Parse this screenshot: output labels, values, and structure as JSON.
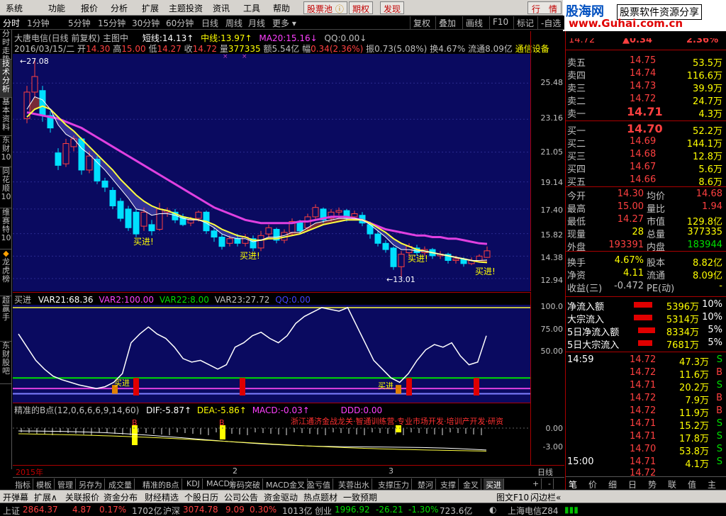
{
  "menu": {
    "items": [
      "系统",
      "功能",
      "报价",
      "分析",
      "扩展",
      "主题投资",
      "资讯",
      "工具",
      "帮助"
    ],
    "stock_pool": "股票池",
    "futures": "期权",
    "discover": "发现",
    "quote_tab": "行　情"
  },
  "logo": {
    "top": "股海网",
    "top_right": "股票软件资源分享",
    "url": "www.Guhai.com.cn"
  },
  "period": {
    "items": [
      "分时",
      "1分钟",
      "5分钟",
      "15分钟",
      "30分钟",
      "60分钟",
      "日线",
      "周线",
      "月线",
      "更多"
    ],
    "buttons": [
      "复权",
      "叠加",
      "画线",
      "F10",
      "标记",
      "-自选"
    ]
  },
  "sidetabs": [
    "分时走势",
    "技术分析",
    "基本资料",
    "东财10",
    "同花顺10",
    "维赛特10",
    "龙虎榜",
    "超赢手",
    "东财股吧"
  ],
  "chart": {
    "title": "大唐电信(日线 前复权) 主图中",
    "short_label": "短线:",
    "short_value": "14.13",
    "mid_label": "中线:",
    "mid_value": "13.97",
    "ma20_label": "MA20:",
    "ma20_value": "15.16",
    "qq_label": "QQ:",
    "qq_value": "0.00",
    "date": "2016/03/15/二",
    "open_label": "开",
    "open": "14.30",
    "high_label": "高",
    "high": "15.00",
    "low_label": "低",
    "low": "14.27",
    "close_label": "收",
    "close": "14.72",
    "vol_label": "量",
    "vol": "377335",
    "amount_label": "额",
    "amount": "5.54亿",
    "change_label": "幅",
    "change": "0.34(2.36%)",
    "amp_label": "振",
    "amp": "0.73(5.08%)",
    "turn_label": "换",
    "turn": "4.67%",
    "float_label": "流通",
    "float": "8.09亿",
    "industry": "通信设备",
    "high_mark": "27.08",
    "low_mark": "13.01",
    "buy_signal": "买进!",
    "axis_labels": [
      "25.48",
      "23.16",
      "21.05",
      "19.14",
      "17.40",
      "15.82",
      "14.38",
      "12.94"
    ]
  },
  "chart_data": {
    "type": "candlestick",
    "title": "大唐电信(日线 前复权) 主图中",
    "ylim": [
      12.94,
      27.08
    ],
    "candles": [
      {
        "o": 23.2,
        "c": 24.9,
        "h": 25.3,
        "l": 22.9
      },
      {
        "o": 24.9,
        "c": 25.9,
        "h": 27.08,
        "l": 24.6
      },
      {
        "o": 25.0,
        "c": 23.4,
        "h": 25.3,
        "l": 23.0
      },
      {
        "o": 23.4,
        "c": 22.6,
        "h": 23.7,
        "l": 22.3
      },
      {
        "o": 21.0,
        "c": 20.2,
        "h": 21.3,
        "l": 19.9
      },
      {
        "o": 20.3,
        "c": 21.6,
        "h": 21.9,
        "l": 20.1
      },
      {
        "o": 21.4,
        "c": 21.9,
        "h": 22.1,
        "l": 21.1
      },
      {
        "o": 21.9,
        "c": 19.9,
        "h": 22.0,
        "l": 19.6
      },
      {
        "o": 19.9,
        "c": 20.8,
        "h": 21.1,
        "l": 19.7
      },
      {
        "o": 20.6,
        "c": 19.2,
        "h": 20.8,
        "l": 19.0
      },
      {
        "o": 19.2,
        "c": 18.8,
        "h": 19.4,
        "l": 18.5
      },
      {
        "o": 18.6,
        "c": 17.6,
        "h": 18.8,
        "l": 17.4
      },
      {
        "o": 17.9,
        "c": 16.8,
        "h": 18.1,
        "l": 16.6
      },
      {
        "o": 17.4,
        "c": 16.2,
        "h": 17.6,
        "l": 16.0
      },
      {
        "o": 17.2,
        "c": 15.8,
        "h": 17.4,
        "l": 15.6
      },
      {
        "o": 16.3,
        "c": 17.2,
        "h": 17.5,
        "l": 16.0
      },
      {
        "o": 16.4,
        "c": 16.0,
        "h": 16.7,
        "l": 15.7
      },
      {
        "o": 16.1,
        "c": 17.4,
        "h": 17.8,
        "l": 16.0
      },
      {
        "o": 17.2,
        "c": 17.3,
        "h": 17.5,
        "l": 16.9
      },
      {
        "o": 17.2,
        "c": 16.7,
        "h": 17.4,
        "l": 16.5
      },
      {
        "o": 16.9,
        "c": 16.4,
        "h": 17.1,
        "l": 16.3
      },
      {
        "o": 16.5,
        "c": 16.7,
        "h": 16.9,
        "l": 16.3
      },
      {
        "o": 16.8,
        "c": 17.2,
        "h": 17.3,
        "l": 16.6
      },
      {
        "o": 17.2,
        "c": 16.0,
        "h": 17.3,
        "l": 15.8
      },
      {
        "o": 16.0,
        "c": 15.6,
        "h": 16.2,
        "l": 15.3
      },
      {
        "o": 15.6,
        "c": 15.0,
        "h": 15.8,
        "l": 14.8
      },
      {
        "o": 15.2,
        "c": 15.5,
        "h": 15.7,
        "l": 15.0
      },
      {
        "o": 15.5,
        "c": 15.2,
        "h": 15.8,
        "l": 15.0
      },
      {
        "o": 15.2,
        "c": 15.6,
        "h": 15.8,
        "l": 15.0
      },
      {
        "o": 15.5,
        "c": 14.9,
        "h": 15.7,
        "l": 14.7
      },
      {
        "o": 14.9,
        "c": 15.7,
        "h": 16.0,
        "l": 14.7
      },
      {
        "o": 15.8,
        "c": 16.2,
        "h": 16.4,
        "l": 15.6
      },
      {
        "o": 16.1,
        "c": 15.4,
        "h": 16.2,
        "l": 15.2
      },
      {
        "o": 15.4,
        "c": 15.9,
        "h": 16.1,
        "l": 15.2
      },
      {
        "o": 15.9,
        "c": 16.6,
        "h": 16.8,
        "l": 15.7
      },
      {
        "o": 16.6,
        "c": 16.0,
        "h": 16.7,
        "l": 15.8
      },
      {
        "o": 16.2,
        "c": 16.9,
        "h": 17.1,
        "l": 16.0
      },
      {
        "o": 16.9,
        "c": 17.5,
        "h": 17.7,
        "l": 16.7
      },
      {
        "o": 17.4,
        "c": 16.7,
        "h": 17.5,
        "l": 16.5
      },
      {
        "o": 16.8,
        "c": 17.2,
        "h": 17.4,
        "l": 16.6
      },
      {
        "o": 17.2,
        "c": 17.3,
        "h": 17.5,
        "l": 17.0
      },
      {
        "o": 17.3,
        "c": 16.8,
        "h": 17.4,
        "l": 16.6
      },
      {
        "o": 16.9,
        "c": 17.1,
        "h": 17.3,
        "l": 16.7
      },
      {
        "o": 17.0,
        "c": 16.5,
        "h": 17.2,
        "l": 16.3
      },
      {
        "o": 16.4,
        "c": 15.8,
        "h": 16.6,
        "l": 15.5
      },
      {
        "o": 15.8,
        "c": 15.2,
        "h": 16.0,
        "l": 15.0
      },
      {
        "o": 15.2,
        "c": 14.8,
        "h": 15.4,
        "l": 14.6
      },
      {
        "o": 14.9,
        "c": 13.7,
        "h": 15.0,
        "l": 13.5
      },
      {
        "o": 13.7,
        "c": 14.5,
        "h": 14.7,
        "l": 13.01
      },
      {
        "o": 14.6,
        "c": 15.0,
        "h": 15.2,
        "l": 14.3
      },
      {
        "o": 14.9,
        "c": 14.6,
        "h": 15.1,
        "l": 14.4
      },
      {
        "o": 14.6,
        "c": 14.8,
        "h": 15.0,
        "l": 14.4
      },
      {
        "o": 14.8,
        "c": 14.4,
        "h": 14.9,
        "l": 14.2
      },
      {
        "o": 14.4,
        "c": 14.5,
        "h": 14.7,
        "l": 14.2
      },
      {
        "o": 14.5,
        "c": 14.1,
        "h": 14.6,
        "l": 13.9
      },
      {
        "o": 14.1,
        "c": 14.2,
        "h": 14.4,
        "l": 13.9
      },
      {
        "o": 14.2,
        "c": 13.9,
        "h": 14.3,
        "l": 13.7
      },
      {
        "o": 13.9,
        "c": 14.1,
        "h": 14.3,
        "l": 13.8
      },
      {
        "o": 14.1,
        "c": 14.38,
        "h": 14.5,
        "l": 14.0
      },
      {
        "o": 14.3,
        "c": 14.72,
        "h": 15.0,
        "l": 14.27
      }
    ],
    "ma20": [
      23.6,
      23.5,
      23.4,
      23.3,
      23.2,
      23.0,
      22.8,
      22.6,
      22.3,
      22.0,
      21.7,
      21.4,
      21.1,
      20.8,
      20.5,
      20.2,
      19.9,
      19.6,
      19.3,
      19.0,
      18.7,
      18.4,
      18.1,
      17.8,
      17.5,
      17.3,
      17.1,
      16.9,
      16.7,
      16.6,
      16.5,
      16.5,
      16.5,
      16.5,
      16.5,
      16.6,
      16.6,
      16.7,
      16.8,
      16.9,
      16.9,
      16.9,
      16.8,
      16.7,
      16.5,
      16.3,
      16.1,
      16.0,
      15.9,
      15.8,
      15.7,
      15.7,
      15.6,
      15.6,
      15.5,
      15.5,
      15.4,
      15.3,
      15.2,
      15.16
    ],
    "short": [
      23.8,
      24.6,
      24.4,
      23.8,
      22.8,
      22.2,
      21.9,
      21.3,
      20.9,
      20.4,
      19.9,
      19.3,
      18.7,
      18.1,
      17.4,
      17.3,
      17.0,
      17.1,
      17.1,
      17.0,
      16.8,
      16.7,
      16.7,
      16.5,
      16.2,
      15.8,
      15.6,
      15.5,
      15.5,
      15.3,
      15.4,
      15.6,
      15.6,
      15.7,
      15.9,
      15.9,
      16.2,
      16.5,
      16.6,
      16.7,
      16.8,
      16.8,
      16.8,
      16.7,
      16.4,
      16.0,
      15.6,
      15.1,
      14.8,
      14.8,
      14.7,
      14.7,
      14.6,
      14.5,
      14.4,
      14.3,
      14.2,
      14.1,
      14.1,
      14.13
    ],
    "mid": [
      23.3,
      23.8,
      24.0,
      23.8,
      23.3,
      22.8,
      22.4,
      21.9,
      21.4,
      20.9,
      20.4,
      19.9,
      19.3,
      18.8,
      18.3,
      17.9,
      17.6,
      17.4,
      17.3,
      17.1,
      16.9,
      16.8,
      16.7,
      16.6,
      16.4,
      16.1,
      15.9,
      15.7,
      15.6,
      15.4,
      15.4,
      15.5,
      15.5,
      15.6,
      15.7,
      15.8,
      16.0,
      16.2,
      16.4,
      16.5,
      16.6,
      16.7,
      16.7,
      16.7,
      16.5,
      16.2,
      15.9,
      15.5,
      15.2,
      15.0,
      14.8,
      14.7,
      14.6,
      14.5,
      14.4,
      14.3,
      14.2,
      14.1,
      14.0,
      13.97
    ]
  },
  "ind1": {
    "name": "买进",
    "var21_label": "VAR21:",
    "var21": "68.36",
    "var2_label": "VAR2:",
    "var2": "100.00",
    "var22_label": "VAR22:",
    "var22": "8.00",
    "var23_label": "VAR23:",
    "var23": "27.72",
    "qq_label": "QQ:",
    "qq": "0.00",
    "buy_text": "买进",
    "axis": [
      "100.0",
      "75.00",
      "50.00"
    ],
    "line": [
      70,
      55,
      40,
      30,
      22,
      18,
      15,
      12,
      10,
      8,
      10,
      15,
      25,
      60,
      70,
      78,
      70,
      65,
      55,
      42,
      38,
      40,
      35,
      30,
      35,
      55,
      60,
      68,
      72,
      65,
      60,
      68,
      82,
      90,
      95,
      100,
      98,
      96,
      100,
      80,
      60,
      40,
      30,
      20,
      15,
      25,
      40,
      52,
      58,
      55,
      60,
      45,
      35,
      38,
      68
    ]
  },
  "ind2": {
    "name": "精准的B点(12,0,6,6,6,9,14,60)",
    "dif_label": "DIF:",
    "dif": "-5.87",
    "dea_label": "DEA:",
    "dea": "-5.86",
    "macd_label": "MACD:",
    "macd": "-0.03",
    "ddd_label": "DDD:",
    "ddd": "0.00",
    "marquee": "浙江通济金战龙关·智通训练营·专业市场开发·培训产开发·研资",
    "b_mark": "B",
    "axis": [
      "0.00",
      "-3.00"
    ]
  },
  "timeaxis": {
    "year": "2015年",
    "m2": "2",
    "m3": "3",
    "right": "日线"
  },
  "bottomtabs": [
    "指标",
    "模板",
    "管理",
    "另存为",
    "成交量",
    "精准的B点",
    "KDJ",
    "MACD",
    "筹码突破",
    "MACD金叉",
    "盈亏值",
    "芙蓉出水",
    "支撑压力",
    "楚河",
    "支撑",
    "金叉",
    "买进",
    "+",
    "-"
  ],
  "bottombar2": [
    "开弹幕",
    "扩展∧",
    "关联报价",
    "资金分布",
    "财经精选",
    "个股日历",
    "公司公告",
    "资金驱动",
    "热点题材",
    "一致预期"
  ],
  "bottombar2_right": [
    "图文F10",
    "闪边栏«"
  ],
  "quote_tabs": [
    "笔",
    "价",
    "细",
    "日",
    "势",
    "联",
    "值",
    "主"
  ],
  "status": {
    "sh_label": "上证",
    "sh": "2864.37",
    "sh_chg": "4.87",
    "sh_pct": "0.17%",
    "sh_amt": "1702亿",
    "hs_label": "沪深",
    "hs": "3074.78",
    "hs_chg": "9.09",
    "hs_pct": "0.30%",
    "hs_amt": "1013亿",
    "cy_label": "创业",
    "cy": "1996.92",
    "cy_chg": "-26.21",
    "cy_pct": "-1.30%",
    "cy_amt": "723.6亿",
    "server": "上海电信Z84"
  },
  "quote": {
    "head_price": "14.72",
    "head_chg": "▲0.34",
    "head_pct": "2.36%",
    "asks": [
      {
        "label": "卖五",
        "price": "14.75",
        "vol": "53.5万"
      },
      {
        "label": "卖四",
        "price": "14.74",
        "vol": "116.6万"
      },
      {
        "label": "卖三",
        "price": "14.73",
        "vol": "39.9万"
      },
      {
        "label": "卖二",
        "price": "14.72",
        "vol": "24.7万"
      },
      {
        "label": "卖一",
        "price": "14.71",
        "vol": "4.3万"
      }
    ],
    "bids": [
      {
        "label": "买一",
        "price": "14.70",
        "vol": "52.2万"
      },
      {
        "label": "买二",
        "price": "14.69",
        "vol": "144.1万"
      },
      {
        "label": "买三",
        "price": "14.68",
        "vol": "12.8万"
      },
      {
        "label": "买四",
        "price": "14.67",
        "vol": "5.6万"
      },
      {
        "label": "买五",
        "price": "14.66",
        "vol": "8.6万"
      }
    ],
    "stats": [
      {
        "l1": "今开",
        "v1": "14.30",
        "l2": "均价",
        "v2": "14.68"
      },
      {
        "l1": "最高",
        "v1": "15.00",
        "l2": "量比",
        "v2": "1.94"
      },
      {
        "l1": "最低",
        "v1": "14.27",
        "l2": "市值",
        "v2": "129.8亿"
      },
      {
        "l1": "现量",
        "v1": "28",
        "l2": "总量",
        "v2": "377335"
      },
      {
        "l1": "外盘",
        "v1": "193391",
        "l2": "内盘",
        "v2": "183944"
      }
    ],
    "stats2": [
      {
        "l1": "换手",
        "v1": "4.67%",
        "l2": "股本",
        "v2": "8.82亿"
      },
      {
        "l1": "净资",
        "v1": "4.11",
        "l2": "流通",
        "v2": "8.09亿"
      },
      {
        "l1": "收益(三)",
        "v1": "-0.472",
        "l2": "PE(动)",
        "v2": "-"
      }
    ],
    "flows": [
      {
        "label": "净流入额",
        "value": "5396万",
        "pct": "10%"
      },
      {
        "label": "大宗流入",
        "value": "5314万",
        "pct": "10%"
      },
      {
        "label": "5日净流入额",
        "value": "8334万",
        "pct": "5%"
      },
      {
        "label": "5日大宗流入",
        "value": "7681万",
        "pct": "5%"
      }
    ],
    "ticks_time": "14:59",
    "ticks": [
      {
        "price": "14.72",
        "vol": "47.3万",
        "bs": "S"
      },
      {
        "price": "14.72",
        "vol": "11.6万",
        "bs": "B"
      },
      {
        "price": "14.71",
        "vol": "20.2万",
        "bs": "S"
      },
      {
        "price": "14.72",
        "vol": "7.9万",
        "bs": "B"
      },
      {
        "price": "14.72",
        "vol": "11.9万",
        "bs": "B"
      },
      {
        "price": "14.71",
        "vol": "15.2万",
        "bs": "S"
      },
      {
        "price": "14.71",
        "vol": "17.8万",
        "bs": "S"
      },
      {
        "price": "14.70",
        "vol": "53.8万",
        "bs": "S"
      }
    ],
    "close_time": "15:00",
    "close_tick": {
      "price": "14.71",
      "vol": "4.1万",
      "bs": "S"
    },
    "last_price": "14.72"
  }
}
